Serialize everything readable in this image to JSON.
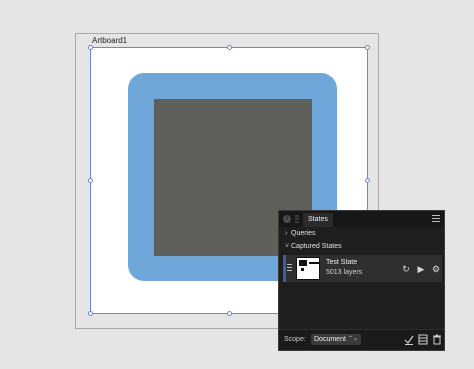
{
  "artboard": {
    "label": "Artboard1"
  },
  "panel": {
    "tab_label": "States",
    "sections": {
      "queries": "Queries",
      "captured": "Captured States"
    },
    "state": {
      "name": "Test State",
      "layers": "5013 layers"
    },
    "footer": {
      "scope_label": "Scope:",
      "scope_value": "Document"
    }
  },
  "colors": {
    "accent": "#3b5ea8",
    "blue_square": "#6fa7d8",
    "gray_square": "#5f605b"
  },
  "icons": [
    "close-icon",
    "grip-icon",
    "panel-menu-icon",
    "chevron-right-icon",
    "chevron-down-icon",
    "drag-handle-icon",
    "refresh-icon",
    "play-icon",
    "gear-icon",
    "capture-icon",
    "list-icon",
    "trash-icon"
  ]
}
